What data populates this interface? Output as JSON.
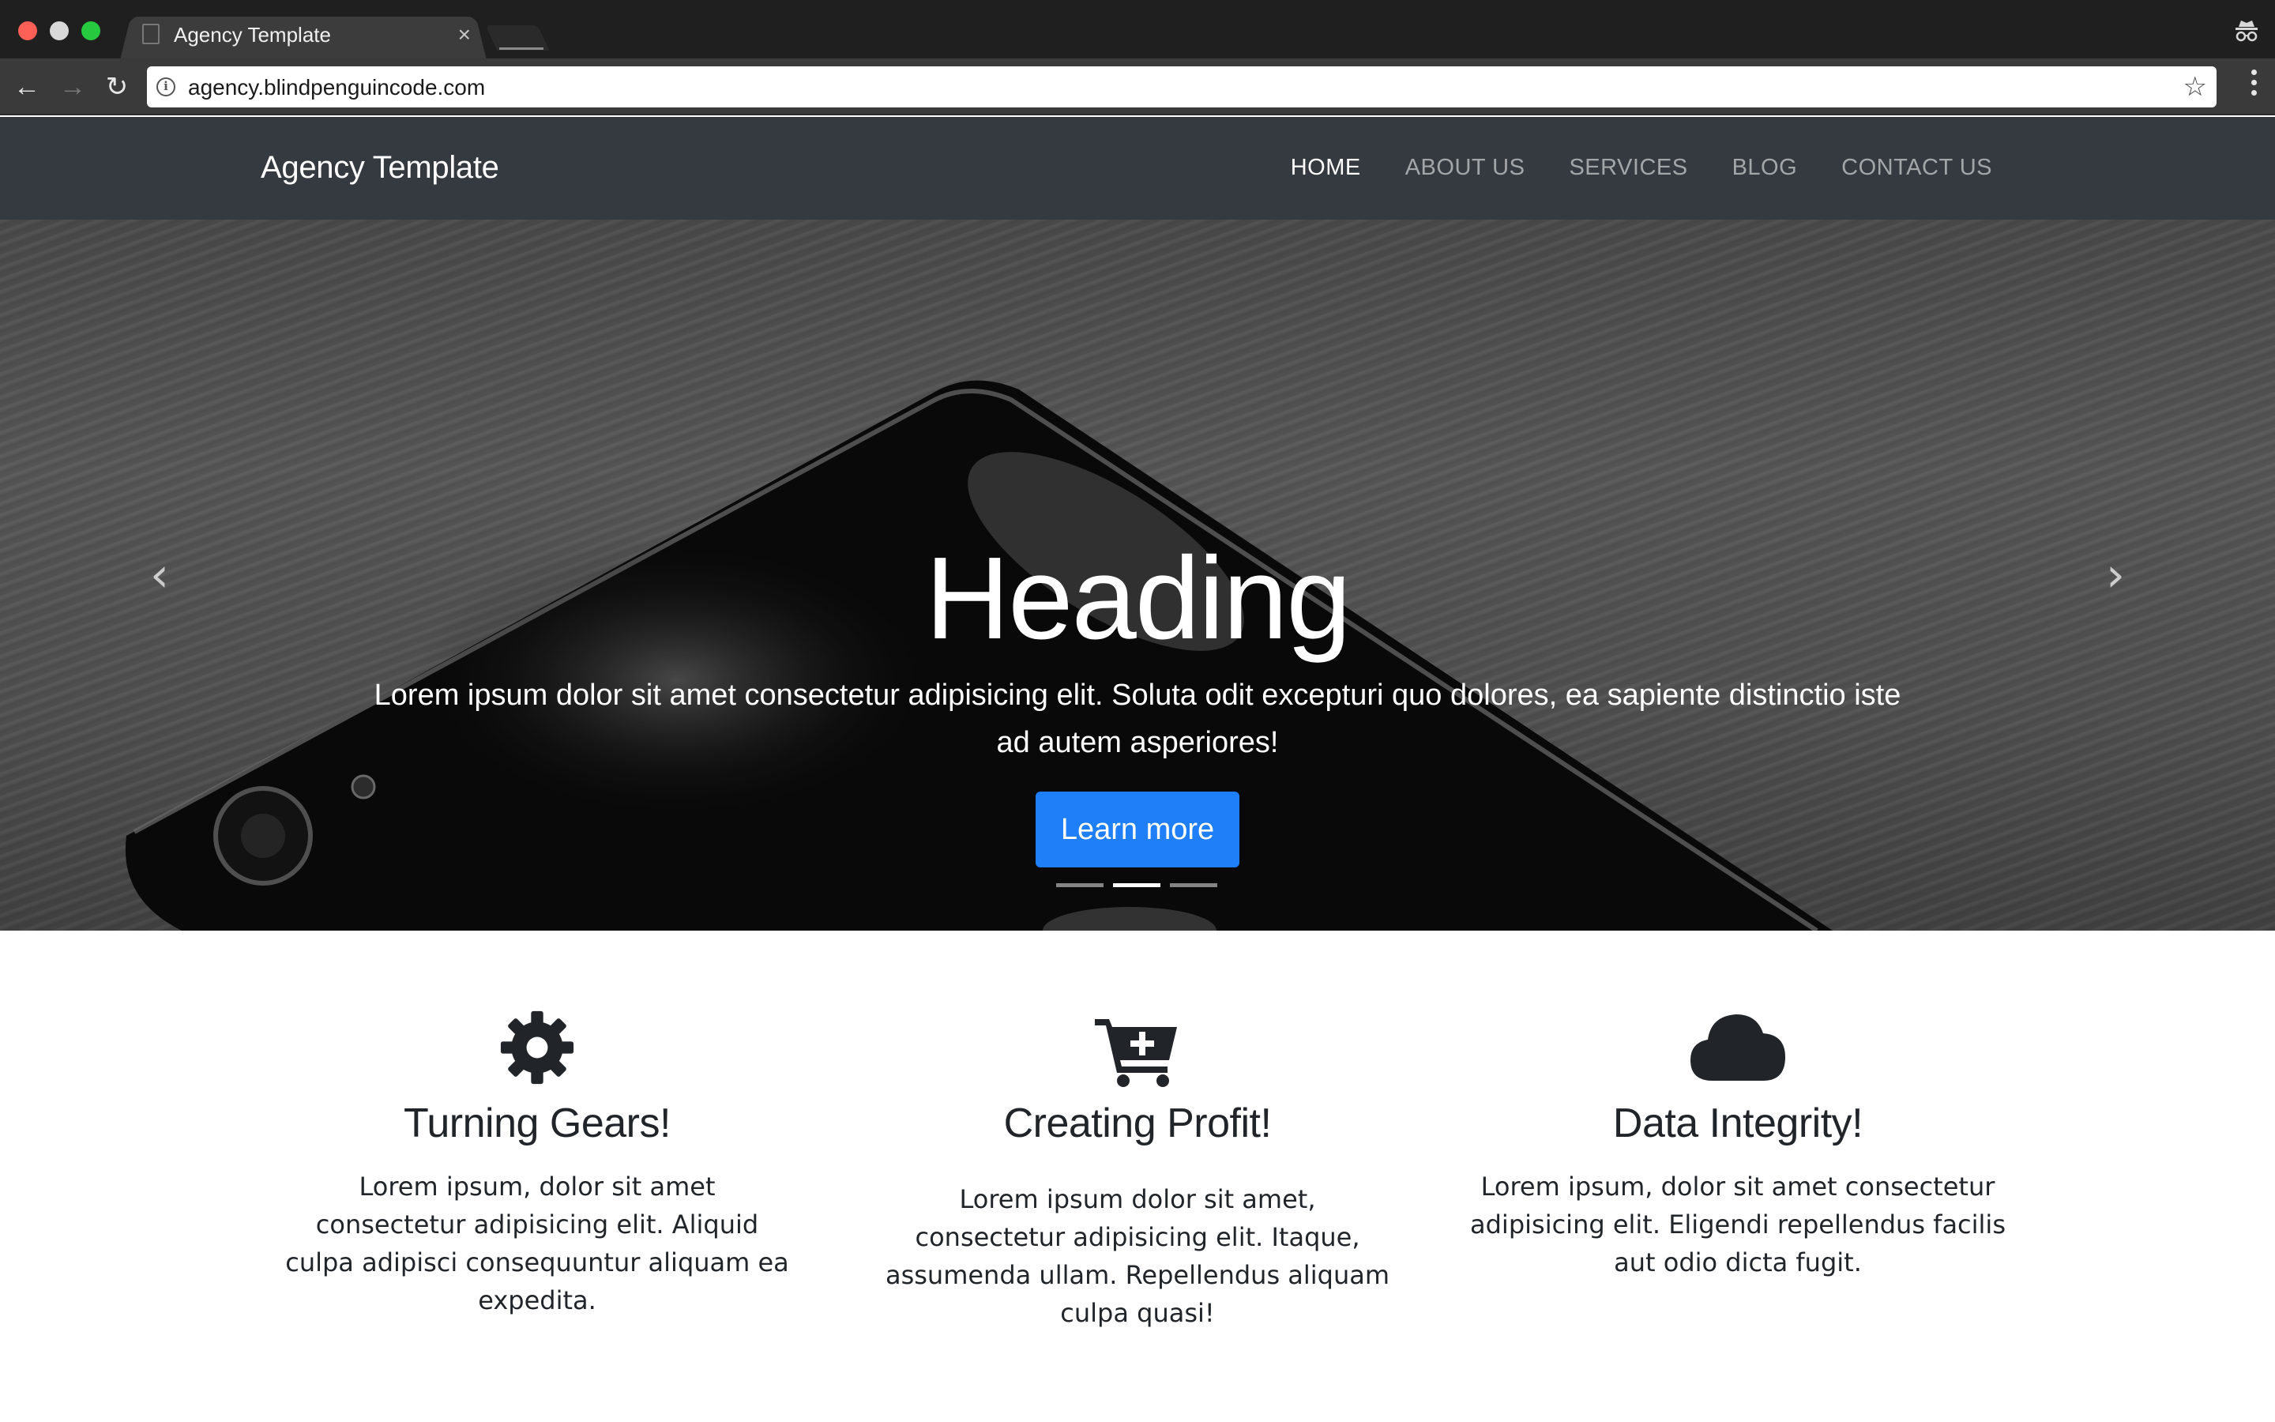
{
  "browser": {
    "tab_title": "Agency Template",
    "tab_close": "×",
    "url": "agency.blindpenguincode.com",
    "back_icon": "←",
    "forward_icon": "→",
    "reload_icon": "↻",
    "star_icon": "☆",
    "info_icon": "i"
  },
  "navbar": {
    "brand": "Agency Template",
    "links": [
      {
        "label": "HOME",
        "active": true
      },
      {
        "label": "ABOUT US",
        "active": false
      },
      {
        "label": "SERVICES",
        "active": false
      },
      {
        "label": "BLOG",
        "active": false
      },
      {
        "label": "CONTACT US",
        "active": false
      }
    ]
  },
  "hero": {
    "heading": "Heading",
    "text": "Lorem ipsum dolor sit amet consectetur adipisicing elit. Soluta odit excepturi quo dolores, ea sapiente distinctio iste ad autem asperiores!",
    "button": "Learn more",
    "prev_icon": "‹",
    "next_icon": "›",
    "slide_count": 3,
    "active_slide": 2
  },
  "features": [
    {
      "icon": "gear-icon",
      "title": "Turning Gears!",
      "text": "Lorem ipsum, dolor sit amet consectetur adipisicing elit. Aliquid culpa adipisci consequuntur aliquam ea expedita."
    },
    {
      "icon": "cart-plus-icon",
      "title": "Creating Profit!",
      "text": "Lorem ipsum dolor sit amet, consectetur adipisicing elit. Itaque, assumenda ullam. Repellendus aliquam culpa quasi!"
    },
    {
      "icon": "cloud-icon",
      "title": "Data Integrity!",
      "text": "Lorem ipsum, dolor sit amet consectetur adipisicing elit. Eligendi repellendus facilis aut odio dicta fugit."
    }
  ],
  "colors": {
    "navbar_bg": "#343a40",
    "primary_button": "#1e7ff8",
    "text_dark": "#212529"
  }
}
